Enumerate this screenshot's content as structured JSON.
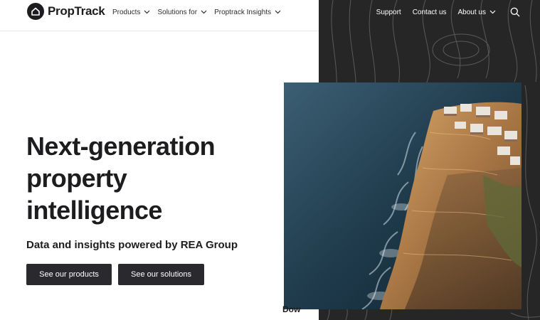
{
  "header": {
    "logo_text": "PropTrack",
    "nav": [
      {
        "label": "Products"
      },
      {
        "label": "Solutions for"
      },
      {
        "label": "Proptrack Insights"
      }
    ],
    "right_nav": {
      "support": "Support",
      "contact": "Contact us",
      "about": "About us"
    }
  },
  "hero": {
    "headline_line1": "Next-generation",
    "headline_line2": "property",
    "headline_line3": "intelligence",
    "subheading": "Data and insights powered by REA Group",
    "btn_products": "See our products",
    "btn_solutions": "See our solutions"
  },
  "stray_text": "Dow",
  "colors": {
    "dark_panel": "#262626",
    "button_bg": "#2a2a2e",
    "text": "#1d1d1f"
  }
}
